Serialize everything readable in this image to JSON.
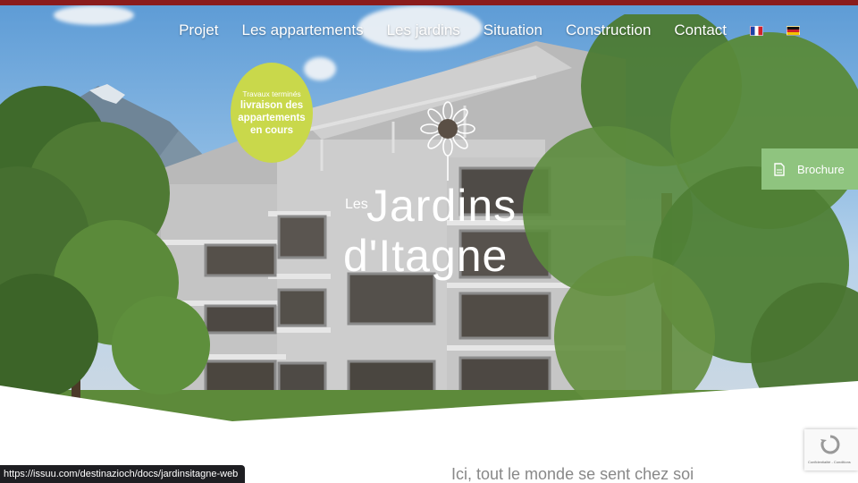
{
  "nav": {
    "items": [
      {
        "label": "Projet"
      },
      {
        "label": "Les appartements"
      },
      {
        "label": "Les jardins"
      },
      {
        "label": "Situation"
      },
      {
        "label": "Construction"
      },
      {
        "label": "Contact"
      }
    ],
    "languages": [
      "fr-flag-icon",
      "de-flag-icon"
    ]
  },
  "badge": {
    "line1": "Travaux terminés",
    "line2": "livraison des appartements en cours",
    "color": "#c9d84b"
  },
  "logo": {
    "small": "Les",
    "line1": "Jardins",
    "line2": "d'Itagne"
  },
  "brochure": {
    "label": "Brochure",
    "icon": "document-icon",
    "color": "#8fc47f"
  },
  "tagline": "Ici, tout le monde se sent chez soi",
  "recaptcha": {
    "text": "Confidentialité - Conditions"
  },
  "status_url": "https://issuu.com/destinazioch/docs/jardinsitagne-web",
  "colors": {
    "top_stripe": "#8a1c1c"
  }
}
